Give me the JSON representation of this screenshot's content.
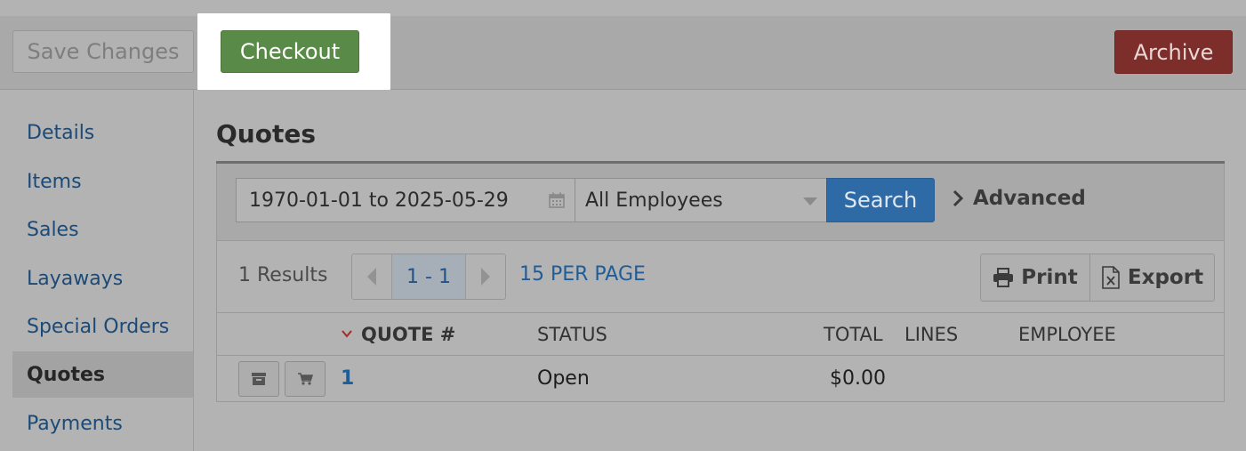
{
  "toolbar": {
    "save_label": "Save Changes",
    "checkout_label": "Checkout",
    "archive_label": "Archive"
  },
  "sidebar": {
    "items": [
      {
        "label": "Details",
        "active": false
      },
      {
        "label": "Items",
        "active": false
      },
      {
        "label": "Sales",
        "active": false
      },
      {
        "label": "Layaways",
        "active": false
      },
      {
        "label": "Special Orders",
        "active": false
      },
      {
        "label": "Quotes",
        "active": true
      },
      {
        "label": "Payments",
        "active": false
      }
    ]
  },
  "main": {
    "title": "Quotes",
    "filters": {
      "date_range": "1970-01-01 to 2025-05-29",
      "employee_selected": "All Employees",
      "search_label": "Search",
      "advanced_label": "Advanced"
    },
    "results": {
      "count_text": "1 Results",
      "page_range": "1 - 1",
      "per_page": "15 PER PAGE",
      "print_label": "Print",
      "export_label": "Export"
    },
    "table": {
      "columns": [
        "QUOTE #",
        "STATUS",
        "TOTAL",
        "LINES",
        "EMPLOYEE"
      ],
      "sort_column": "QUOTE #",
      "rows": [
        {
          "quote_no": "1",
          "status": "Open",
          "total": "$0.00",
          "lines": "",
          "employee": ""
        }
      ]
    }
  },
  "colors": {
    "checkout": "#5a8a47",
    "archive": "#7d2e2a",
    "search": "#2e6aa6",
    "link": "#1c4a78"
  },
  "icons": [
    "calendar-icon",
    "chevron-down-icon",
    "chevron-right-icon",
    "chevron-left-icon",
    "printer-icon",
    "excel-file-icon",
    "archive-box-icon",
    "cart-icon",
    "sort-desc-icon"
  ]
}
